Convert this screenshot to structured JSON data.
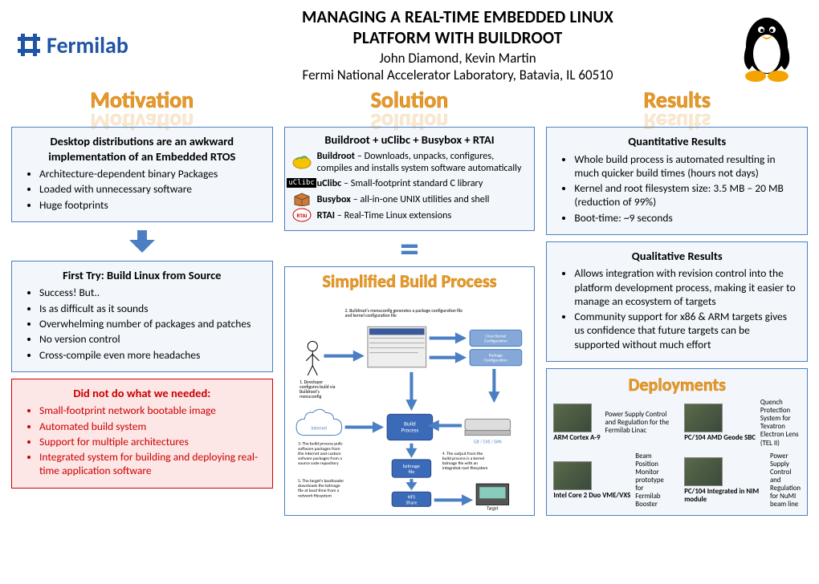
{
  "header": {
    "title_line1": "MANAGING A REAL-TIME EMBEDDED LINUX",
    "title_line2": "PLATFORM WITH BUILDROOT",
    "authors": "John Diamond, Kevin Martin",
    "affiliation": "Fermi National Accelerator Laboratory, Batavia, IL 60510",
    "logo_text": "Fermilab"
  },
  "sections": {
    "motivation": "Motivation",
    "solution": "Solution",
    "results": "Results"
  },
  "motivation": {
    "box1": {
      "title_line1": "Desktop distributions are an awkward",
      "title_line2": "implementation of an Embedded RTOS",
      "bullets": [
        "Architecture-dependent binary Packages",
        "Loaded with unnecessary software",
        "Huge footprints"
      ]
    },
    "box2": {
      "title": "First Try: Build Linux from Source",
      "bullets": [
        "Success!  But..",
        "Is as difficult as it sounds",
        "Overwhelming number of packages and patches",
        "No version control",
        "Cross-compile even more headaches"
      ]
    },
    "box3": {
      "title": "Did not do what we needed:",
      "bullets": [
        "Small-footprint network bootable image",
        "Automated build system",
        "Support for multiple architectures",
        "Integrated system for building and deploying real-time application software"
      ]
    }
  },
  "solution": {
    "heading": "Buildroot + uClibc + Busybox + RTAI",
    "items": [
      {
        "name": "Buildroot",
        "desc": " – Downloads, unpacks, configures, compiles and installs system software automatically"
      },
      {
        "name": "uClibc",
        "desc": " – Small-footprint standard C library"
      },
      {
        "name": "Busybox",
        "desc": " – all-in-one UNIX utilities and shell"
      },
      {
        "name": "RTAI",
        "desc": " – Real-Time Linux extensions"
      }
    ],
    "diagram_title": "Simplified Build Process",
    "diagram": {
      "step1": "1. Developer configures build via Buildroot's menuconfig",
      "step2": "2. Buildroot's menuconfig generates a package configuration file and kernel configuration file",
      "step3": "3. The build process pulls software packages from the internet and custom software packages from a source code repository",
      "step4": "4. The output from the build process is a kernel bzImage file with an integrated root filesystem",
      "step5": "5. The target's bootloader downloads the bzImage file at boot time from a network filesystem",
      "labels": {
        "kernel_cfg": "Linux Kernel Configuration",
        "pkg_cfg": "Package Configuration",
        "internet": "Internet",
        "build": "Build Process",
        "svn": "Git / CVS / SVN",
        "bzimage": "bzImage file",
        "nfs": "NFS Share",
        "target": "Target"
      }
    }
  },
  "results": {
    "quant": {
      "title": "Quantitative Results",
      "bullets": [
        "Whole build process is automated resulting in much quicker build times (hours not days)",
        "Kernel and root filesystem size: 3.5 MB – 20 MB (reduction of 99%)",
        "Boot-time: ~9 seconds"
      ]
    },
    "qual": {
      "title": "Qualitative Results",
      "bullets": [
        "Allows integration with revision control into the platform development process, making it easier to manage an ecosystem of targets",
        "Community support for x86 & ARM targets gives us confidence that future targets can be supported without much effort"
      ]
    },
    "deploy_title": "Deployments",
    "deployments": [
      {
        "desc": "Power Supply Control and Regulation for the Fermilab Linac",
        "hw": "ARM Cortex A-9"
      },
      {
        "desc": "Quench Protection System for Tevatron Electron Lens (TEL II)",
        "hw": "PC/104 AMD Geode SBC"
      },
      {
        "desc": "Beam Position Monitor prototype for Fermilab Booster",
        "hw": "Intel Core 2 Duo VME/VXS"
      },
      {
        "desc": "Power Supply Control and Regulation for NuMI beam line",
        "hw": "PC/104 Integrated in NIM module"
      }
    ]
  }
}
